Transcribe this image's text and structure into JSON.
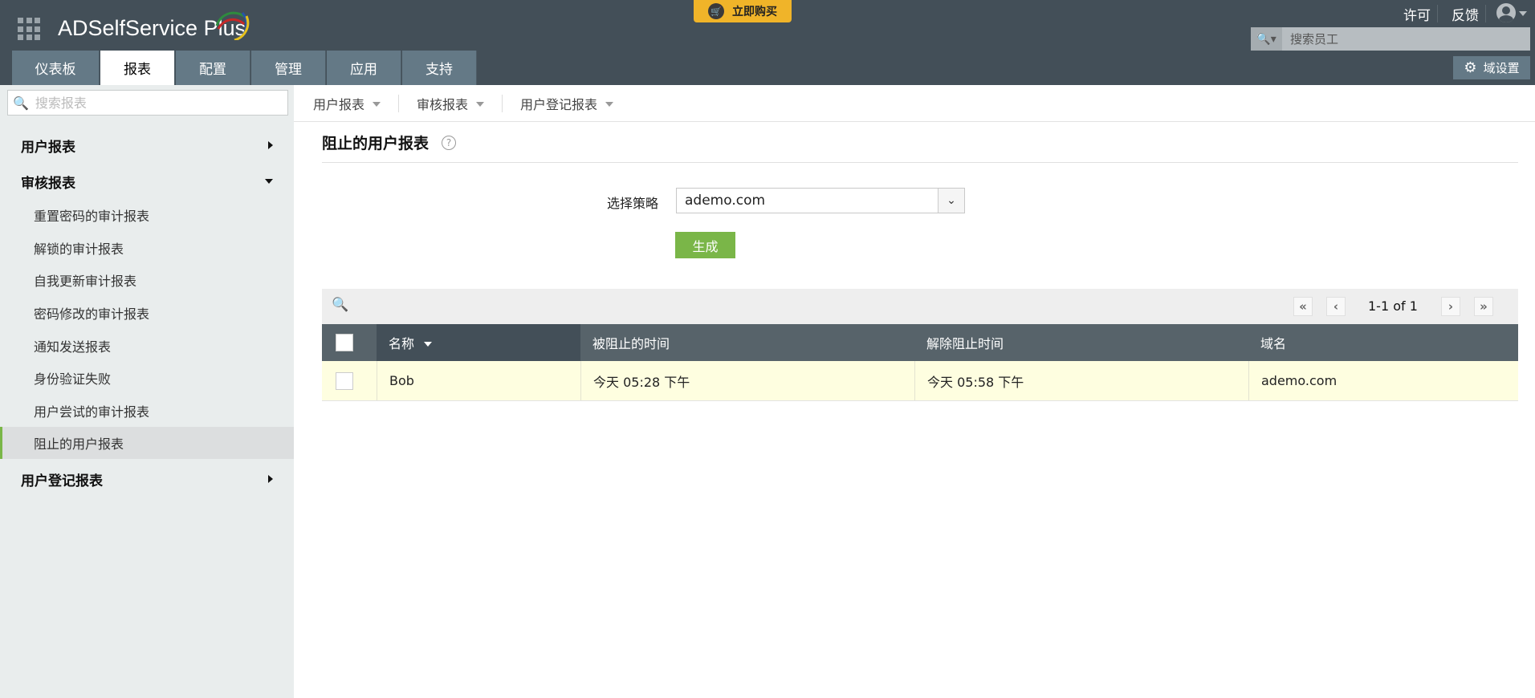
{
  "header": {
    "app_name": "ADSelfService Plus",
    "buy_label": "立即购买",
    "license": "许可",
    "feedback": "反馈",
    "employee_search_placeholder": "搜索员工",
    "domain_settings": "域设置"
  },
  "tabs": [
    {
      "label": "仪表板"
    },
    {
      "label": "报表"
    },
    {
      "label": "配置"
    },
    {
      "label": "管理"
    },
    {
      "label": "应用"
    },
    {
      "label": "支持"
    }
  ],
  "sidebar": {
    "search_placeholder": "搜索报表",
    "groups": [
      {
        "label": "用户报表"
      },
      {
        "label": "审核报表"
      },
      {
        "label": "用户登记报表"
      }
    ],
    "items": [
      {
        "label": "重置密码的审计报表"
      },
      {
        "label": "解锁的审计报表"
      },
      {
        "label": "自我更新审计报表"
      },
      {
        "label": "密码修改的审计报表"
      },
      {
        "label": "通知发送报表"
      },
      {
        "label": "身份验证失败"
      },
      {
        "label": "用户尝试的审计报表"
      },
      {
        "label": "阻止的用户报表"
      }
    ]
  },
  "subnav": [
    {
      "label": "用户报表"
    },
    {
      "label": "审核报表"
    },
    {
      "label": "用户登记报表"
    }
  ],
  "main": {
    "title": "阻止的用户报表",
    "help": "?",
    "policy_label": "选择策略",
    "policy_value": "ademo.com",
    "generate": "生成",
    "pagination": "1-1 of 1",
    "columns": [
      "名称",
      "被阻止的时间",
      "解除阻止时间",
      "域名"
    ],
    "rows": [
      {
        "name": "Bob",
        "blocked": "今天 05:28 下午",
        "unblocked": "今天 05:58 下午",
        "domain": "ademo.com"
      }
    ]
  },
  "colors": {
    "header": "#434f58",
    "tab": "#647986",
    "accent": "#7ab648",
    "buy": "#f0b429",
    "row_highlight": "#fefee0"
  }
}
